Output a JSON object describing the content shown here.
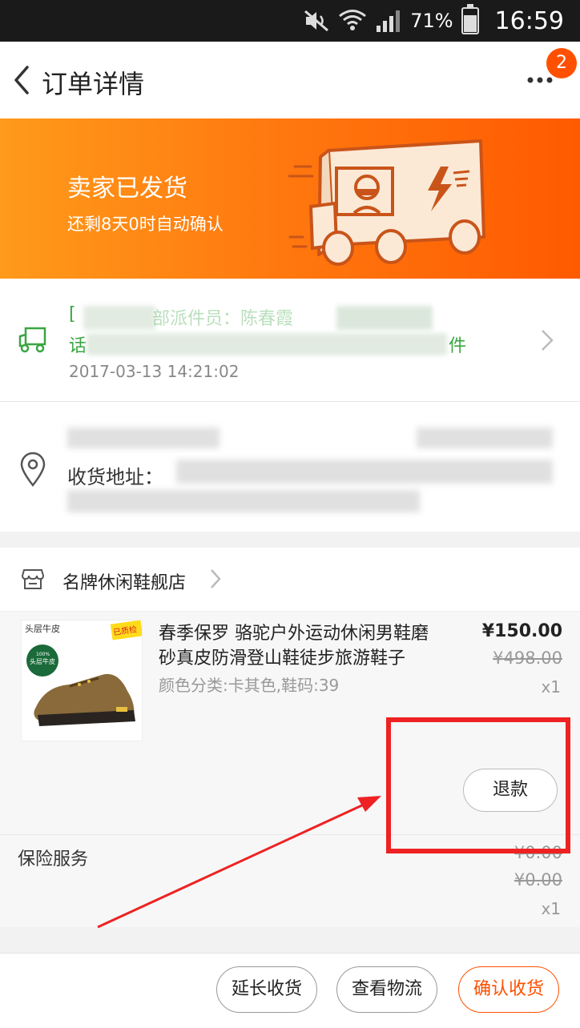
{
  "status_bar": {
    "battery": "71%",
    "time": "16:59"
  },
  "nav": {
    "title": "订单详情",
    "badge_count": "2"
  },
  "banner": {
    "title": "卖家已发货",
    "subtitle": "还剩8天0时自动确认"
  },
  "logistics": {
    "line1_prefix": "[",
    "line1_visible": "部派件员：陈春霞",
    "line2_prefix": "话",
    "line2_suffix": "件",
    "time": "2017-03-13 14:21:02"
  },
  "address": {
    "label": "收货地址："
  },
  "shop": {
    "name": "名牌休闲鞋舰店"
  },
  "product": {
    "title": "春季保罗 骆驼户外运动休闲男鞋磨砂真皮防滑登山鞋徒步旅游鞋子",
    "sku": "颜色分类:卡其色,鞋码:39",
    "price": "¥150.00",
    "original_price": "¥498.00",
    "quantity": "x1",
    "refund_label": "退款",
    "image_tags": [
      "头层牛皮",
      "已质检",
      "100%",
      "头层牛皮"
    ]
  },
  "insurance": {
    "label": "保险服务",
    "price": "¥0.00",
    "original_price": "¥0.00",
    "quantity": "x1"
  },
  "bottom_bar": {
    "extend_label": "延长收货",
    "logistics_label": "查看物流",
    "confirm_label": "确认收货"
  },
  "colors": {
    "accent": "#ff5000",
    "logistics_green": "#3aa641",
    "annotation_red": "#ee2222"
  }
}
